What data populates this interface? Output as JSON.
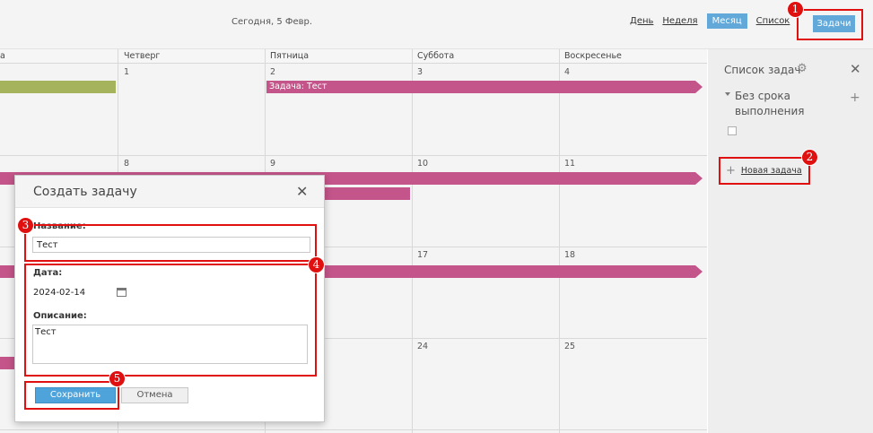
{
  "toolbar": {
    "today": "Сегодня, 5 Февр.",
    "views": [
      "День",
      "Неделя",
      "Месяц",
      "Список"
    ],
    "active_view": "Месяц",
    "tasks_button": "Задачи"
  },
  "calendar": {
    "partial_first_col": "а",
    "columns": [
      "Четверг",
      "Пятница",
      "Суббота",
      "Воскресенье"
    ],
    "days": [
      "1",
      "2",
      "3",
      "4",
      "8",
      "9",
      "10",
      "11",
      "17",
      "18",
      "24",
      "25"
    ],
    "event_label": "Задача: Тест",
    "colors": {
      "task_event": "#c4558a",
      "other_event": "#a4b35c"
    }
  },
  "panel": {
    "title": "Список задач",
    "group_label": "Без срока выполнения",
    "new_task": "Новая задача"
  },
  "modal": {
    "title": "Создать задачу",
    "name_label": "Название:",
    "name_value": "Тест",
    "date_label": "Дата:",
    "date_value": "2024-02-14",
    "description_label": "Описание:",
    "description_value": "Тест",
    "save": "Сохранить",
    "cancel": "Отмена"
  },
  "callouts": [
    "1",
    "2",
    "3",
    "4",
    "5"
  ],
  "colors": {
    "accent": "#62a8d8",
    "callout": "#e01010"
  }
}
